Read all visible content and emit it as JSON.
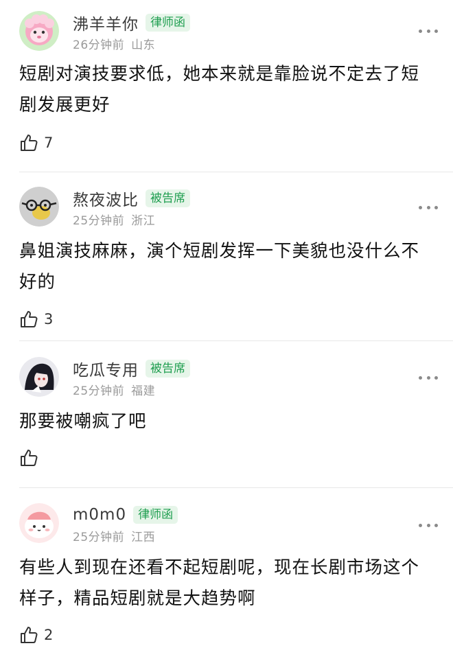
{
  "comments": [
    {
      "username": "沸羊羊你",
      "badge": "律师函",
      "time": "26分钟前",
      "location": "山东",
      "text": "短剧对演技要求低，她本来就是靠脸说不定去了短剧发展更好",
      "likes": "7",
      "avatar_icon": "pink-sheep-avatar"
    },
    {
      "username": "熬夜波比",
      "badge": "被告席",
      "time": "25分钟前",
      "location": "浙江",
      "text": "鼻姐演技麻麻，演个短剧发挥一下美貌也没什么不好的",
      "likes": "3",
      "avatar_icon": "duck-with-glasses-avatar"
    },
    {
      "username": "吃瓜专用",
      "badge": "被告席",
      "time": "25分钟前",
      "location": "福建",
      "text": "那要被嘲疯了吧",
      "likes": "",
      "avatar_icon": "anime-character-avatar"
    },
    {
      "username": "m0m0",
      "badge": "律师函",
      "time": "25分钟前",
      "location": "江西",
      "text": "有些人到现在还看不起短剧呢，现在长剧市场这个样子，精品短剧就是大趋势啊",
      "likes": "2",
      "avatar_icon": "peach-character-avatar"
    }
  ],
  "colors": {
    "badge_bg": "#e6f5e9",
    "badge_text": "#1f9e50",
    "meta_text": "#9a9a9a",
    "divider": "#e7e7e7"
  },
  "icons": [
    "thumbs-up-icon",
    "more-dots-icon"
  ]
}
